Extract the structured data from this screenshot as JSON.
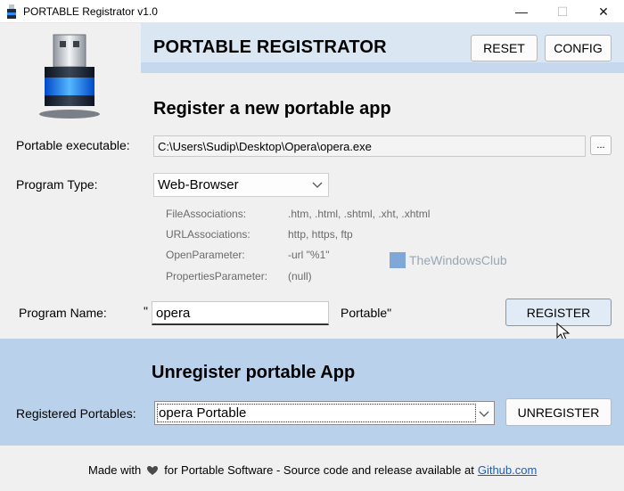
{
  "window": {
    "title": "PORTABLE Registrator v1.0",
    "minimize_glyph": "—",
    "maximize_glyph": "☐",
    "close_glyph": "✕"
  },
  "header": {
    "app_title": "PORTABLE REGISTRATOR",
    "reset_label": "RESET",
    "config_label": "CONFIG"
  },
  "register": {
    "section_title": "Register a new portable app",
    "exe_label": "Portable executable:",
    "exe_value": "C:\\Users\\Sudip\\Desktop\\Opera\\opera.exe",
    "browse_label": "...",
    "program_type_label": "Program Type:",
    "program_type_value": "Web-Browser",
    "info": [
      {
        "key": "FileAssociations:",
        "value": ".htm, .html, .shtml, .xht, .xhtml"
      },
      {
        "key": "URLAssociations:",
        "value": "http, https, ftp"
      },
      {
        "key": "OpenParameter:",
        "value": "-url \"%1\""
      },
      {
        "key": "PropertiesParameter:",
        "value": "(null)"
      }
    ],
    "program_name_label": "Program Name:",
    "quote_open": "\"",
    "program_name_value": "opera",
    "portable_suffix": "Portable\"",
    "register_label": "REGISTER"
  },
  "watermark": {
    "text": "TheWindowsClub"
  },
  "unregister": {
    "section_title": "Unregister portable App",
    "registered_label": "Registered Portables:",
    "selected_value": "opera Portable",
    "unregister_label": "UNREGISTER"
  },
  "footer": {
    "made_with": "Made with",
    "rest": "for Portable Software - Source code and release available at",
    "link": "Github.com"
  },
  "colors": {
    "header_band": "#dbe6f3",
    "unregister_area": "#b9d1eb",
    "link": "#1a5fc0",
    "register_button_border": "#6b9cd0"
  }
}
